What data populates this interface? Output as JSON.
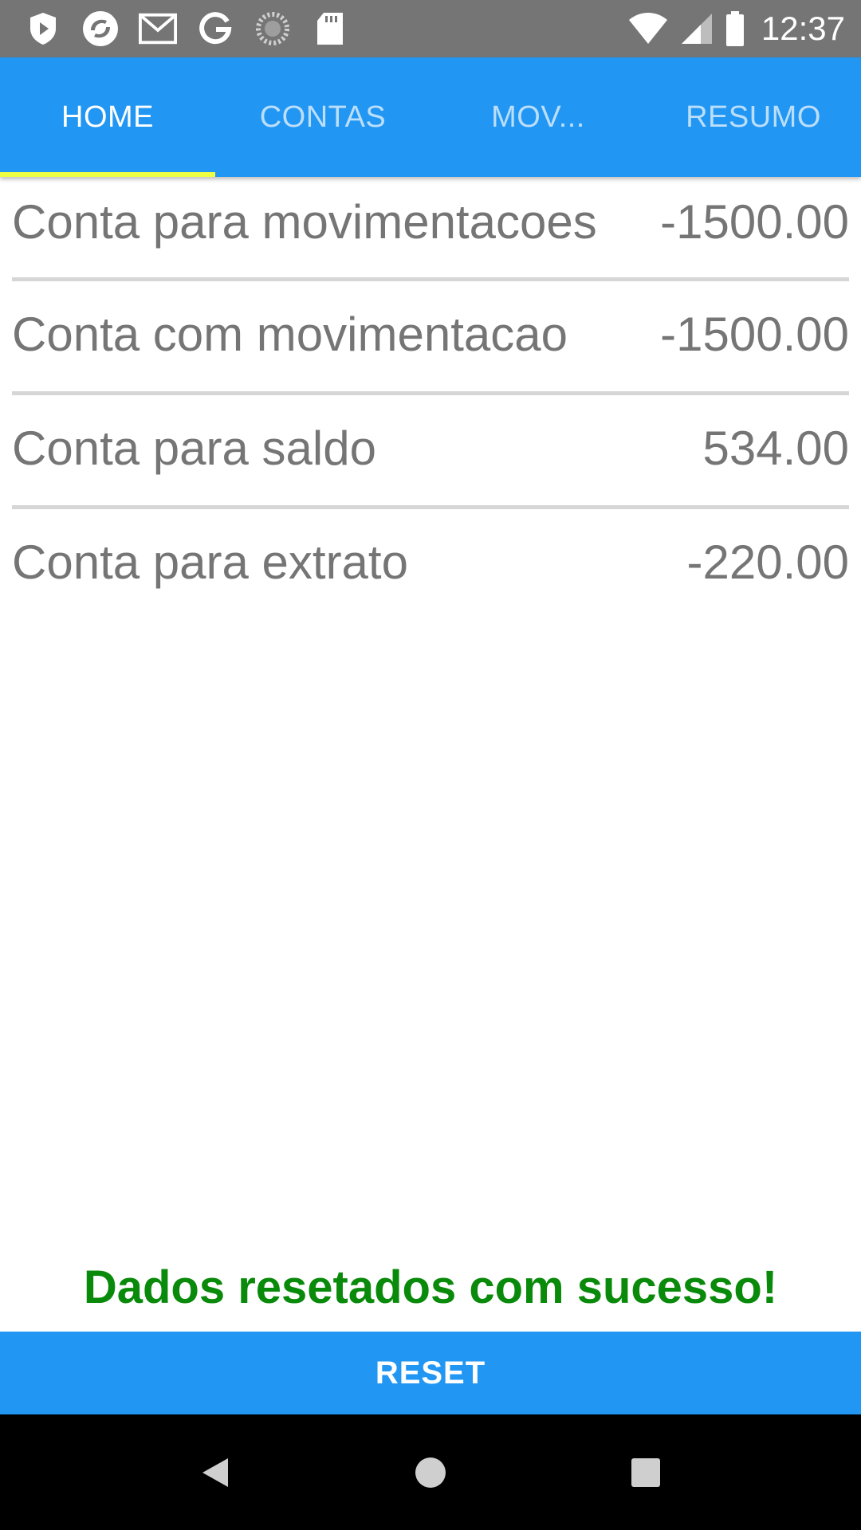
{
  "status_bar": {
    "time": "12:37",
    "left_icons": [
      "play-protect-icon",
      "sync-app-icon",
      "gmail-icon",
      "google-icon",
      "loading-icon",
      "sd-card-icon"
    ],
    "right_icons": [
      "wifi-icon",
      "signal-icon",
      "battery-icon"
    ]
  },
  "tabs": [
    {
      "label": "HOME",
      "active": true
    },
    {
      "label": "CONTAS",
      "active": false
    },
    {
      "label": "MOV...",
      "active": false
    },
    {
      "label": "RESUMO",
      "active": false
    }
  ],
  "accounts": [
    {
      "name": "Conta para movimentacoes",
      "balance": "-1500.00"
    },
    {
      "name": "Conta com movimentacao",
      "balance": "-1500.00"
    },
    {
      "name": "Conta para saldo",
      "balance": "534.00"
    },
    {
      "name": "Conta para extrato",
      "balance": "-220.00"
    }
  ],
  "message": "Dados resetados com sucesso!",
  "reset_button": {
    "label": "RESET"
  },
  "colors": {
    "primary": "#2196F3",
    "tab_indicator": "#EEFF41",
    "success": "#0A8A0A",
    "status_bar": "#757575"
  }
}
